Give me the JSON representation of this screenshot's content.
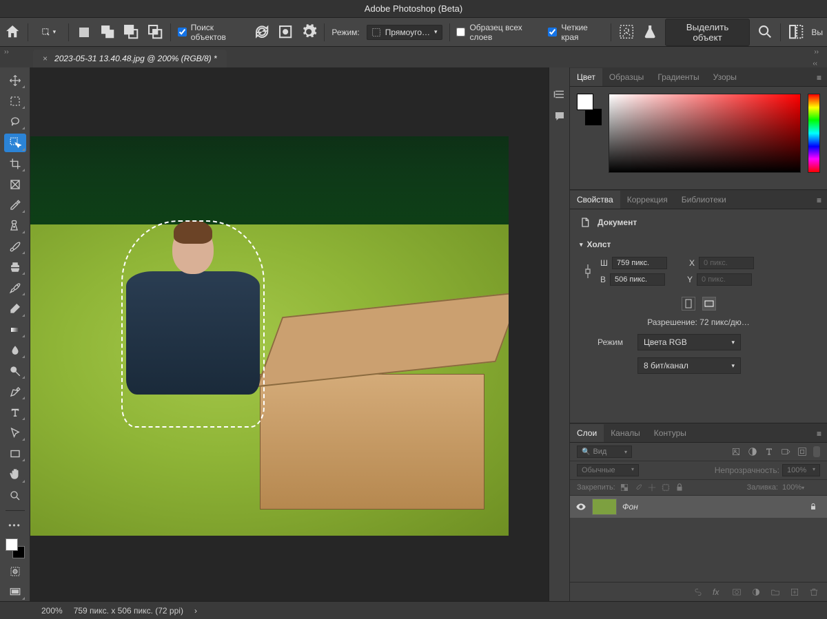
{
  "app_title": "Adobe Photoshop (Beta)",
  "doc_tab": "2023-05-31 13.40.48.jpg @ 200% (RGB/8) *",
  "options": {
    "find_objects": "Поиск объектов",
    "mode_label": "Режим:",
    "mode_value": "Прямоуго…",
    "sample_all": "Образец всех слоев",
    "hard_edge": "Четкие края",
    "select_subject": "Выделить объект",
    "select_mask": "Вы"
  },
  "status": {
    "zoom": "200%",
    "doc_info": "759 пикс. x 506 пикс. (72 ppi)"
  },
  "color_tabs": {
    "color": "Цвет",
    "swatches": "Образцы",
    "gradients": "Градиенты",
    "patterns": "Узоры"
  },
  "props_tabs": {
    "properties": "Свойства",
    "adjust": "Коррекция",
    "libraries": "Библиотеки"
  },
  "props": {
    "document": "Документ",
    "canvas_section": "Холст",
    "w_label": "Ш",
    "w_value": "759 пикс.",
    "h_label": "В",
    "h_value": "506 пикс.",
    "x_label": "X",
    "x_value": "0 пикс.",
    "y_label": "Y",
    "y_value": "0 пикс.",
    "resolution": "Разрешение: 72 пикс/дю…",
    "mode_label": "Режим",
    "mode_value": "Цвета RGB",
    "depth_value": "8 бит/канал"
  },
  "layers_tabs": {
    "layers": "Слои",
    "channels": "Каналы",
    "paths": "Контуры"
  },
  "layers": {
    "filter_kind": "Вид",
    "blend_mode": "Обычные",
    "opacity_label": "Непрозрачность:",
    "opacity_value": "100%",
    "lock_label": "Закрепить:",
    "fill_label": "Заливка:",
    "fill_value": "100%",
    "layer_name": "Фон"
  }
}
